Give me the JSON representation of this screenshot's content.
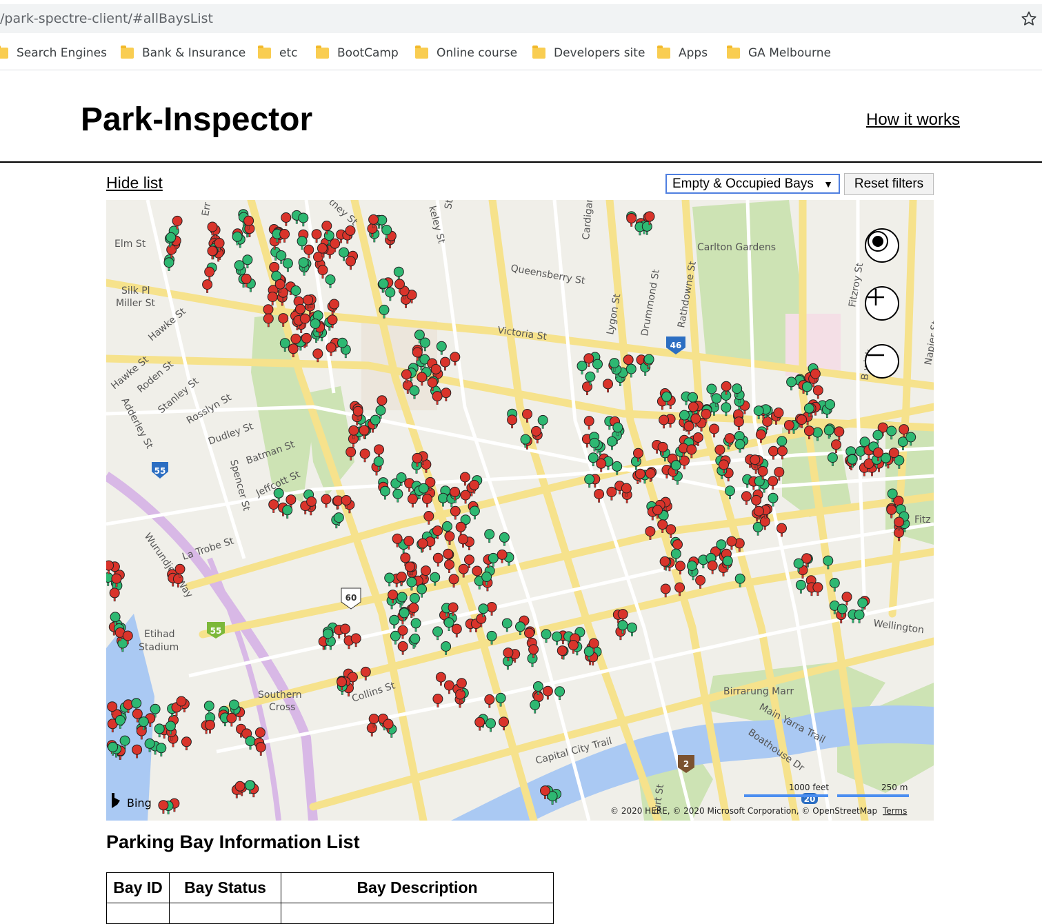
{
  "browser": {
    "url": "/park-spectre-client/#allBaysList",
    "bookmarks": [
      {
        "label": "Search Engines"
      },
      {
        "label": "Bank & Insurance"
      },
      {
        "label": "etc"
      },
      {
        "label": "BootCamp"
      },
      {
        "label": "Online course"
      },
      {
        "label": "Developers site"
      },
      {
        "label": "Apps"
      },
      {
        "label": "GA Melbourne"
      }
    ]
  },
  "header": {
    "title": "Park-Inspector",
    "how_link": "How it works"
  },
  "controls": {
    "hide_list": "Hide list",
    "filter_value": "Empty & Occupied Bays",
    "filter_arrow": "▼",
    "reset": "Reset filters"
  },
  "map": {
    "provider": "Bing",
    "copyright": "© 2020 HERE, © 2020 Microsoft Corporation, © OpenStreetMap",
    "terms": "Terms",
    "scale_feet": "1000 feet",
    "scale_m": "250 m",
    "labels": {
      "elm": "Elm St",
      "silk": "Silk Pl",
      "miller": "Miller St",
      "hawke1": "Hawke St",
      "hawke2": "Hawke St",
      "roden": "Roden St",
      "stanley": "Stanley St",
      "rosslyn": "Rosslyn St",
      "adderley": "Adderley St",
      "dudley": "Dudley St",
      "batman": "Batman St",
      "jeffcott": "Jeffcott St",
      "spencer": "Spencer St",
      "latrobe": "La Trobe St",
      "wurundjeri": "Wurundjeri Way",
      "etihad1": "Etihad",
      "etihad2": "Stadium",
      "southern1": "Southern",
      "southern2": "Cross",
      "collins": "Collins St",
      "capital": "Capital City Trail",
      "queensberry": "Queensberry St",
      "victoria": "Victoria St",
      "carlton": "Carlton Gardens",
      "lygon": "Lygon St",
      "drummond": "Drummond St",
      "rathdowne": "Rathdowne St",
      "fitzroy": "Fitzroy St",
      "napier": "Napier St",
      "fitz": "Fitz",
      "wellington": "Wellington",
      "birrarung": "Birrarung Marr",
      "mainyarra": "Main Yarra Trail",
      "boathouse": "Boathouse Dr",
      "cardigan": "Cardigan",
      "keley": "keley St",
      "tney": "tney St",
      "errol": "Err",
      "brunswick": "B   wick",
      "turst": "turt St",
      "st": "St"
    },
    "route_shields": [
      "55",
      "55",
      "60",
      "46",
      "2",
      "20"
    ],
    "colors": {
      "occupied": "#d9342b",
      "empty": "#2eb872",
      "road": "#f6e59c",
      "park": "#c9e2b0",
      "water": "#a9c7f2"
    }
  },
  "list": {
    "title": "Parking Bay Information List",
    "headers": [
      "Bay ID",
      "Bay Status",
      "Bay Description"
    ]
  }
}
